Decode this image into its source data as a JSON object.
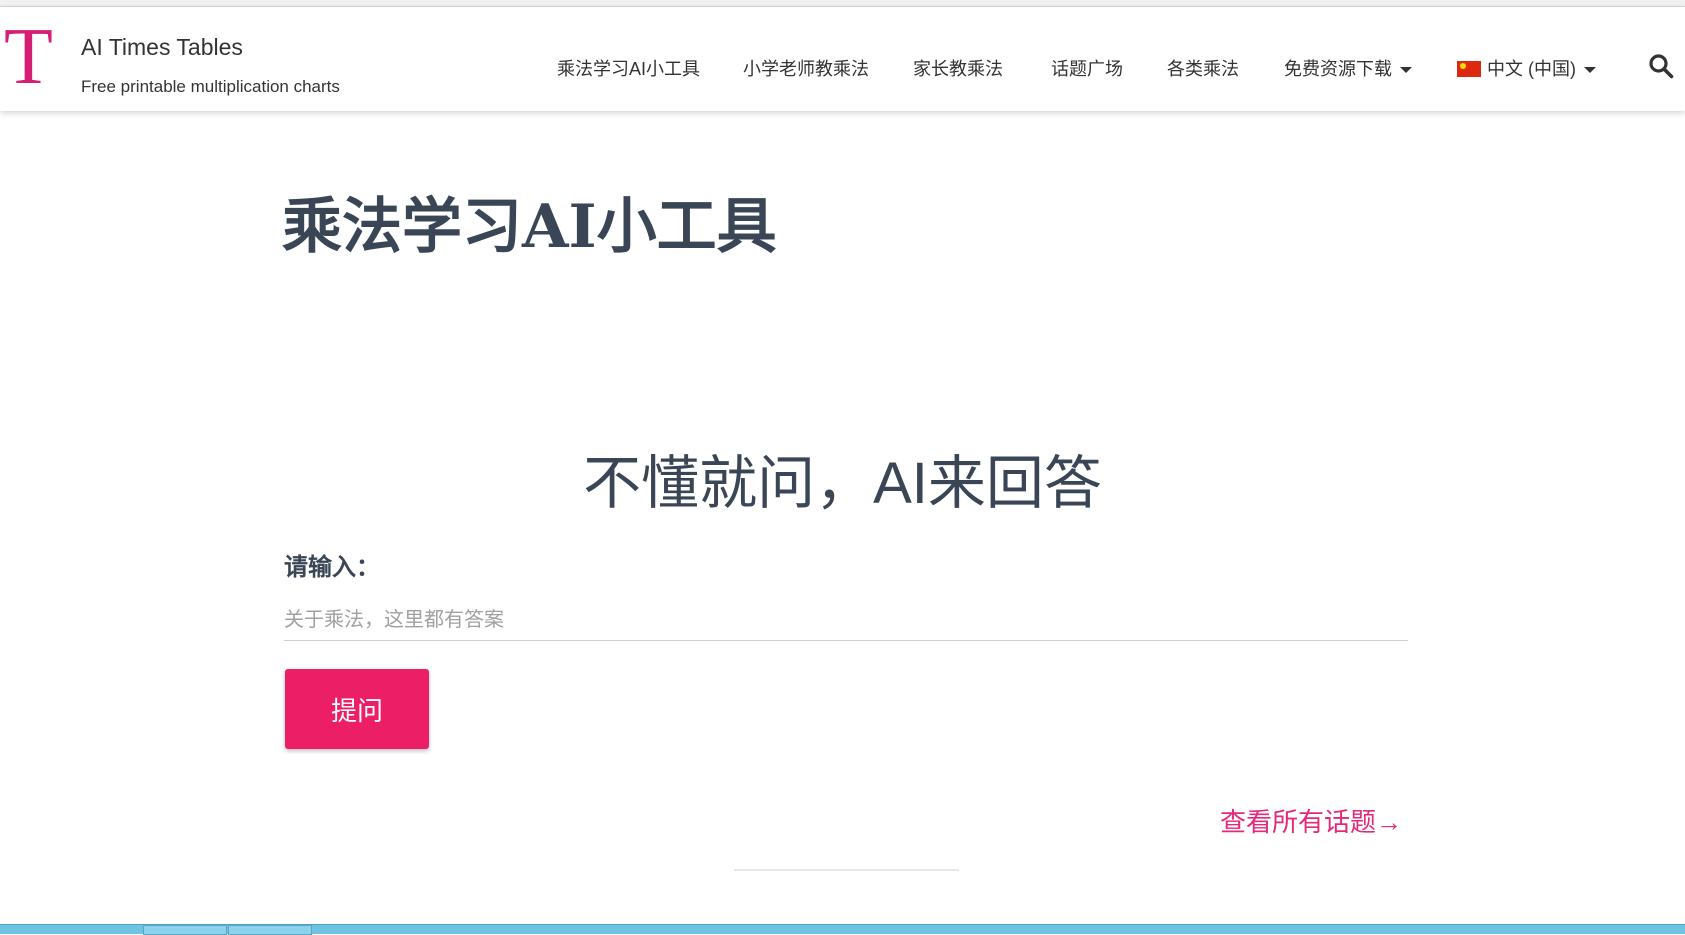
{
  "brand": {
    "logo_letter": "T",
    "name": "AI Times Tables",
    "tagline": "Free printable multiplication charts",
    "accent_color": "#d41f74"
  },
  "nav": {
    "items": [
      {
        "label": "乘法学习AI小工具"
      },
      {
        "label": "小学老师教乘法"
      },
      {
        "label": "家长教乘法"
      },
      {
        "label": "话题广场"
      },
      {
        "label": "各类乘法"
      },
      {
        "label": "免费资源下载",
        "dropdown": true
      }
    ],
    "language": {
      "label": "中文 (中国)",
      "flag": "cn-flag-icon"
    },
    "search_icon": "search-icon"
  },
  "main": {
    "title": "乘法学习AI小工具",
    "hero": "不懂就问，AI来回答",
    "input_label": "请输入：",
    "input_placeholder": "关于乘法，这里都有答案",
    "input_value": "",
    "ask_button": "提问",
    "ask_button_color": "#ec1f66",
    "all_topics_link": "查看所有话题→"
  }
}
